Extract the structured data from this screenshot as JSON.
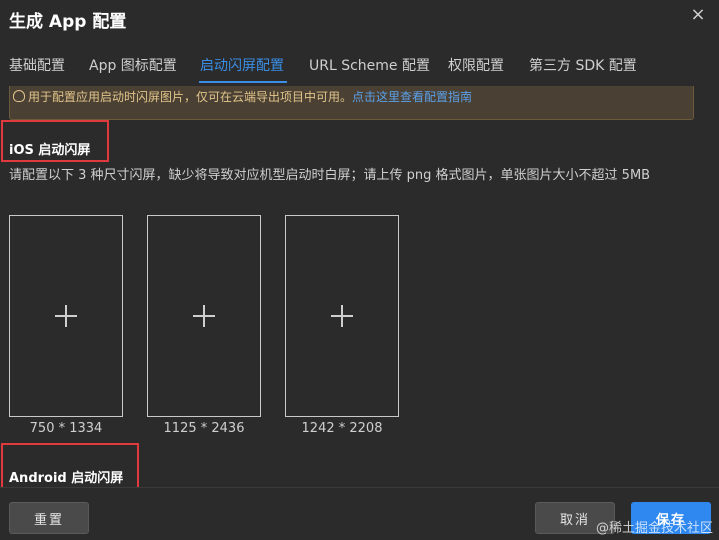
{
  "dialog": {
    "title": "生成 App 配置",
    "close_glyph": "×"
  },
  "tabs": [
    {
      "label": "基础配置"
    },
    {
      "label": "App 图标配置"
    },
    {
      "label": "启动闪屏配置"
    },
    {
      "label": "URL Scheme 配置"
    },
    {
      "label": "权限配置"
    },
    {
      "label": "第三方 SDK 配置"
    }
  ],
  "active_tab": 2,
  "notice": {
    "icon": "lightbulb-icon",
    "text": "用于配置应用启动时闪屏图片，仅可在云端导出项目中可用。",
    "link": "点击这里查看配置指南"
  },
  "ios": {
    "title": "iOS 启动闪屏",
    "description": "请配置以下 3 种尺寸闪屏，缺少将导致对应机型启动时白屏；请上传 png 格式图片，单张图片大小不超过 5MB",
    "slots": [
      {
        "size": "750 * 1334"
      },
      {
        "size": "1125 * 2436"
      },
      {
        "size": "1242 * 2208"
      }
    ]
  },
  "android": {
    "title": "Android 启动闪屏"
  },
  "footer": {
    "reset_label": "重置",
    "cancel_label": "取消",
    "save_label": "保存"
  },
  "watermark": "@稀土掘金技术社区",
  "colors": {
    "accent": "#3a8ee6",
    "highlight_box": "#e0393e",
    "save_button": "#2f88f0"
  }
}
